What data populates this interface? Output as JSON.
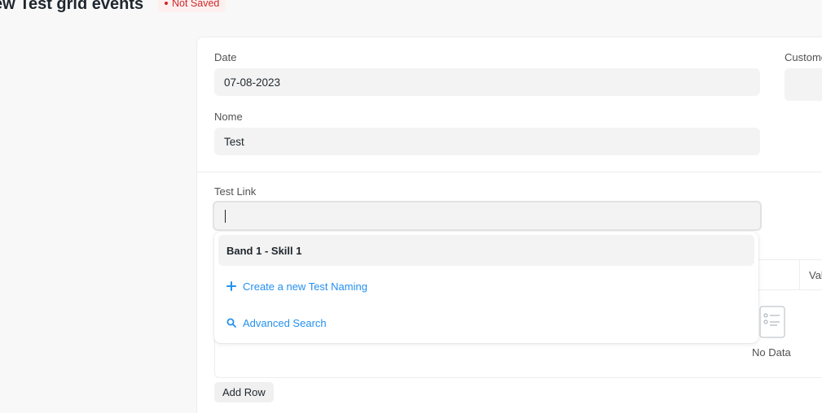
{
  "header": {
    "title": "ew Test grid events",
    "status": "Not Saved"
  },
  "form": {
    "date": {
      "label": "Date",
      "value": "07-08-2023"
    },
    "customer": {
      "label": "Custome"
    },
    "nome": {
      "label": "Nome",
      "value": "Test"
    },
    "test_link": {
      "label": "Test Link",
      "value": ""
    }
  },
  "grid": {
    "column_label": "Val",
    "empty_text": "No Data",
    "add_row_label": "Add Row"
  },
  "dropdown": {
    "items": [
      {
        "label": "Band 1 - Skill 1",
        "type": "option",
        "icon": ""
      },
      {
        "label": "Create a new Test Naming",
        "type": "action",
        "icon": "plus-icon"
      },
      {
        "label": "Advanced Search",
        "type": "action",
        "icon": "search-icon"
      }
    ]
  },
  "colors": {
    "accent": "#2490ef",
    "status_text": "#cc2929",
    "status_bg": "#fff0f0"
  }
}
